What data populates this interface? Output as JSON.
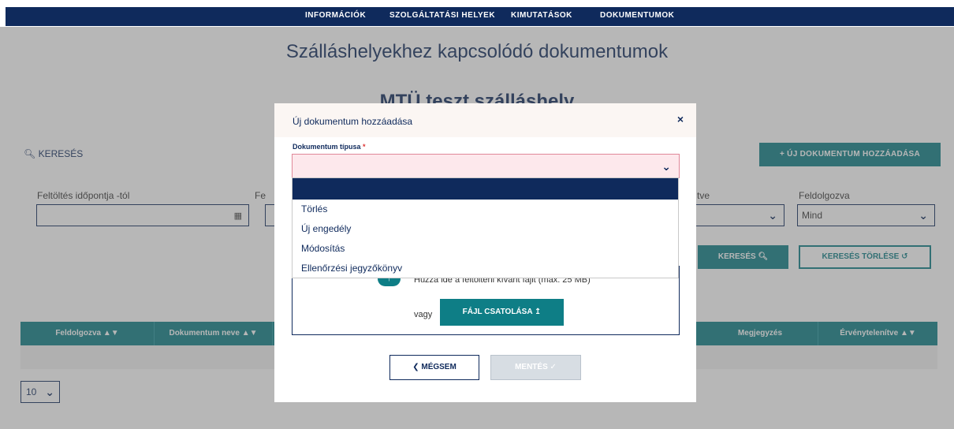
{
  "nav": {
    "items": [
      "INFORMÁCIÓK",
      "SZOLGÁLTATÁSI HELYEK",
      "KIMUTATÁSOK",
      "DOKUMENTUMOK"
    ]
  },
  "page": {
    "title": "Szálláshelyekhez kapcsolódó dokumentumok",
    "place_title": "MTÜ teszt szálláshely"
  },
  "toolbar": {
    "search_label": "KERESÉS",
    "add_doc_label": "ÚJ DOKUMENTUM HOZZÁADÁSA"
  },
  "filters": {
    "upload_from_label": "Feltöltés időpontja -tól",
    "upload_from_value": "",
    "second_label_fragment": "Fe",
    "invalidated_label_fragment": "tve",
    "processed_label": "Feldolgozva",
    "processed_value": "Mind",
    "search_button": "KERESÉS",
    "clear_button": "KERESÉS TÖRLÉSE"
  },
  "table": {
    "columns": [
      "Feldolgozva",
      "Dokumentum neve",
      "Megjegyzés",
      "Érvénytelenítve"
    ],
    "page_size": "10"
  },
  "modal": {
    "title": "Új dokumentum hozzáadása",
    "close_glyph": "×",
    "doc_type_label": "Dokumentum típusa",
    "required_mark": "*",
    "doc_type_value": "",
    "options": [
      "",
      "Törlés",
      "Új engedély",
      "Módosítás",
      "Ellenőrzési jegyzőkönyv"
    ],
    "upload_hint": "Húzza ide a feltölteni kívánt fájlt (max. 25 MB)",
    "or_text": "vagy",
    "attach_button": "FÁJL CSATOLÁSA",
    "cancel_button": "MÉGSEM",
    "save_button": "MENTÉS"
  },
  "colors": {
    "navy": "#0f2a5c",
    "teal": "#0e7e86",
    "overlay": "#606060"
  }
}
